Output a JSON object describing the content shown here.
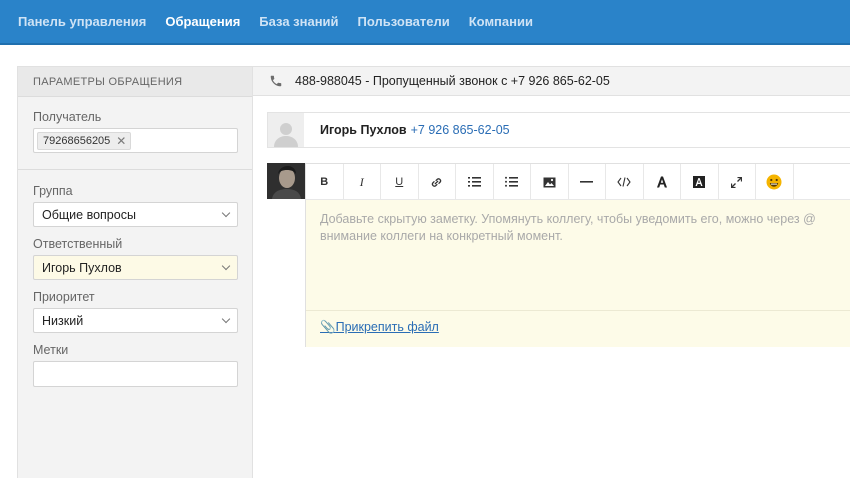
{
  "nav": {
    "items": [
      {
        "label": "Панель управления"
      },
      {
        "label": "Обращения"
      },
      {
        "label": "База знаний"
      },
      {
        "label": "Пользователи"
      },
      {
        "label": "Компании"
      }
    ],
    "active_index": 1
  },
  "sidebar": {
    "title": "ПАРАМЕТРЫ ОБРАЩЕНИЯ",
    "recipient_label": "Получатель",
    "recipient_tag": "79268656205",
    "group_label": "Группа",
    "group_value": "Общие вопросы",
    "assignee_label": "Ответственный",
    "assignee_value": "Игорь Пухлов",
    "priority_label": "Приоритет",
    "priority_value": "Низкий",
    "tags_label": "Метки",
    "tags_value": ""
  },
  "ticket": {
    "title": "488-988045 - Пропущенный звонок с +7 926 865-62-05"
  },
  "contact": {
    "name": "Игорь Пухлов",
    "phone": "+7 926 865-62-05"
  },
  "editor": {
    "placeholder": "Добавьте скрытую заметку. Упомянуть коллегу, чтобы уведомить его, можно через @\nвнимание коллеги на конкретный момент.",
    "attach_label": "Прикрепить файл",
    "toolbar": {
      "bold": "B",
      "italic": "I",
      "underline": "U"
    }
  },
  "colors": {
    "nav_bg": "#2a83c9",
    "link": "#2a6db5",
    "note_bg": "#fdfbe8"
  }
}
